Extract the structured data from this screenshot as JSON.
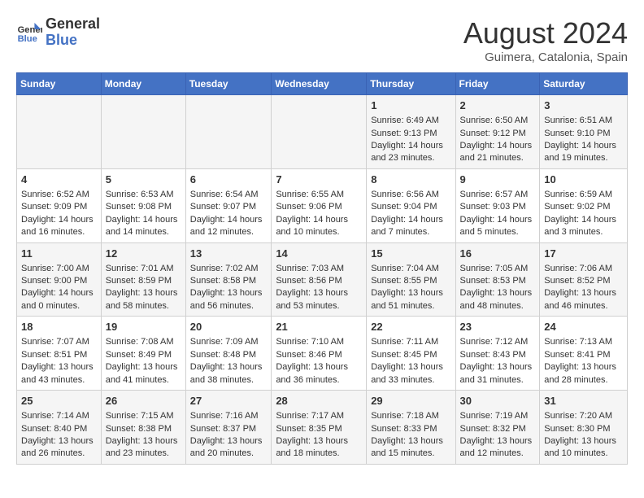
{
  "header": {
    "logo_line1": "General",
    "logo_line2": "Blue",
    "month_year": "August 2024",
    "location": "Guimera, Catalonia, Spain"
  },
  "days_of_week": [
    "Sunday",
    "Monday",
    "Tuesday",
    "Wednesday",
    "Thursday",
    "Friday",
    "Saturday"
  ],
  "weeks": [
    [
      {
        "day": "",
        "sunrise": "",
        "sunset": "",
        "daylight": ""
      },
      {
        "day": "",
        "sunrise": "",
        "sunset": "",
        "daylight": ""
      },
      {
        "day": "",
        "sunrise": "",
        "sunset": "",
        "daylight": ""
      },
      {
        "day": "",
        "sunrise": "",
        "sunset": "",
        "daylight": ""
      },
      {
        "day": "1",
        "sunrise": "Sunrise: 6:49 AM",
        "sunset": "Sunset: 9:13 PM",
        "daylight": "Daylight: 14 hours and 23 minutes."
      },
      {
        "day": "2",
        "sunrise": "Sunrise: 6:50 AM",
        "sunset": "Sunset: 9:12 PM",
        "daylight": "Daylight: 14 hours and 21 minutes."
      },
      {
        "day": "3",
        "sunrise": "Sunrise: 6:51 AM",
        "sunset": "Sunset: 9:10 PM",
        "daylight": "Daylight: 14 hours and 19 minutes."
      }
    ],
    [
      {
        "day": "4",
        "sunrise": "Sunrise: 6:52 AM",
        "sunset": "Sunset: 9:09 PM",
        "daylight": "Daylight: 14 hours and 16 minutes."
      },
      {
        "day": "5",
        "sunrise": "Sunrise: 6:53 AM",
        "sunset": "Sunset: 9:08 PM",
        "daylight": "Daylight: 14 hours and 14 minutes."
      },
      {
        "day": "6",
        "sunrise": "Sunrise: 6:54 AM",
        "sunset": "Sunset: 9:07 PM",
        "daylight": "Daylight: 14 hours and 12 minutes."
      },
      {
        "day": "7",
        "sunrise": "Sunrise: 6:55 AM",
        "sunset": "Sunset: 9:06 PM",
        "daylight": "Daylight: 14 hours and 10 minutes."
      },
      {
        "day": "8",
        "sunrise": "Sunrise: 6:56 AM",
        "sunset": "Sunset: 9:04 PM",
        "daylight": "Daylight: 14 hours and 7 minutes."
      },
      {
        "day": "9",
        "sunrise": "Sunrise: 6:57 AM",
        "sunset": "Sunset: 9:03 PM",
        "daylight": "Daylight: 14 hours and 5 minutes."
      },
      {
        "day": "10",
        "sunrise": "Sunrise: 6:59 AM",
        "sunset": "Sunset: 9:02 PM",
        "daylight": "Daylight: 14 hours and 3 minutes."
      }
    ],
    [
      {
        "day": "11",
        "sunrise": "Sunrise: 7:00 AM",
        "sunset": "Sunset: 9:00 PM",
        "daylight": "Daylight: 14 hours and 0 minutes."
      },
      {
        "day": "12",
        "sunrise": "Sunrise: 7:01 AM",
        "sunset": "Sunset: 8:59 PM",
        "daylight": "Daylight: 13 hours and 58 minutes."
      },
      {
        "day": "13",
        "sunrise": "Sunrise: 7:02 AM",
        "sunset": "Sunset: 8:58 PM",
        "daylight": "Daylight: 13 hours and 56 minutes."
      },
      {
        "day": "14",
        "sunrise": "Sunrise: 7:03 AM",
        "sunset": "Sunset: 8:56 PM",
        "daylight": "Daylight: 13 hours and 53 minutes."
      },
      {
        "day": "15",
        "sunrise": "Sunrise: 7:04 AM",
        "sunset": "Sunset: 8:55 PM",
        "daylight": "Daylight: 13 hours and 51 minutes."
      },
      {
        "day": "16",
        "sunrise": "Sunrise: 7:05 AM",
        "sunset": "Sunset: 8:53 PM",
        "daylight": "Daylight: 13 hours and 48 minutes."
      },
      {
        "day": "17",
        "sunrise": "Sunrise: 7:06 AM",
        "sunset": "Sunset: 8:52 PM",
        "daylight": "Daylight: 13 hours and 46 minutes."
      }
    ],
    [
      {
        "day": "18",
        "sunrise": "Sunrise: 7:07 AM",
        "sunset": "Sunset: 8:51 PM",
        "daylight": "Daylight: 13 hours and 43 minutes."
      },
      {
        "day": "19",
        "sunrise": "Sunrise: 7:08 AM",
        "sunset": "Sunset: 8:49 PM",
        "daylight": "Daylight: 13 hours and 41 minutes."
      },
      {
        "day": "20",
        "sunrise": "Sunrise: 7:09 AM",
        "sunset": "Sunset: 8:48 PM",
        "daylight": "Daylight: 13 hours and 38 minutes."
      },
      {
        "day": "21",
        "sunrise": "Sunrise: 7:10 AM",
        "sunset": "Sunset: 8:46 PM",
        "daylight": "Daylight: 13 hours and 36 minutes."
      },
      {
        "day": "22",
        "sunrise": "Sunrise: 7:11 AM",
        "sunset": "Sunset: 8:45 PM",
        "daylight": "Daylight: 13 hours and 33 minutes."
      },
      {
        "day": "23",
        "sunrise": "Sunrise: 7:12 AM",
        "sunset": "Sunset: 8:43 PM",
        "daylight": "Daylight: 13 hours and 31 minutes."
      },
      {
        "day": "24",
        "sunrise": "Sunrise: 7:13 AM",
        "sunset": "Sunset: 8:41 PM",
        "daylight": "Daylight: 13 hours and 28 minutes."
      }
    ],
    [
      {
        "day": "25",
        "sunrise": "Sunrise: 7:14 AM",
        "sunset": "Sunset: 8:40 PM",
        "daylight": "Daylight: 13 hours and 26 minutes."
      },
      {
        "day": "26",
        "sunrise": "Sunrise: 7:15 AM",
        "sunset": "Sunset: 8:38 PM",
        "daylight": "Daylight: 13 hours and 23 minutes."
      },
      {
        "day": "27",
        "sunrise": "Sunrise: 7:16 AM",
        "sunset": "Sunset: 8:37 PM",
        "daylight": "Daylight: 13 hours and 20 minutes."
      },
      {
        "day": "28",
        "sunrise": "Sunrise: 7:17 AM",
        "sunset": "Sunset: 8:35 PM",
        "daylight": "Daylight: 13 hours and 18 minutes."
      },
      {
        "day": "29",
        "sunrise": "Sunrise: 7:18 AM",
        "sunset": "Sunset: 8:33 PM",
        "daylight": "Daylight: 13 hours and 15 minutes."
      },
      {
        "day": "30",
        "sunrise": "Sunrise: 7:19 AM",
        "sunset": "Sunset: 8:32 PM",
        "daylight": "Daylight: 13 hours and 12 minutes."
      },
      {
        "day": "31",
        "sunrise": "Sunrise: 7:20 AM",
        "sunset": "Sunset: 8:30 PM",
        "daylight": "Daylight: 13 hours and 10 minutes."
      }
    ]
  ]
}
